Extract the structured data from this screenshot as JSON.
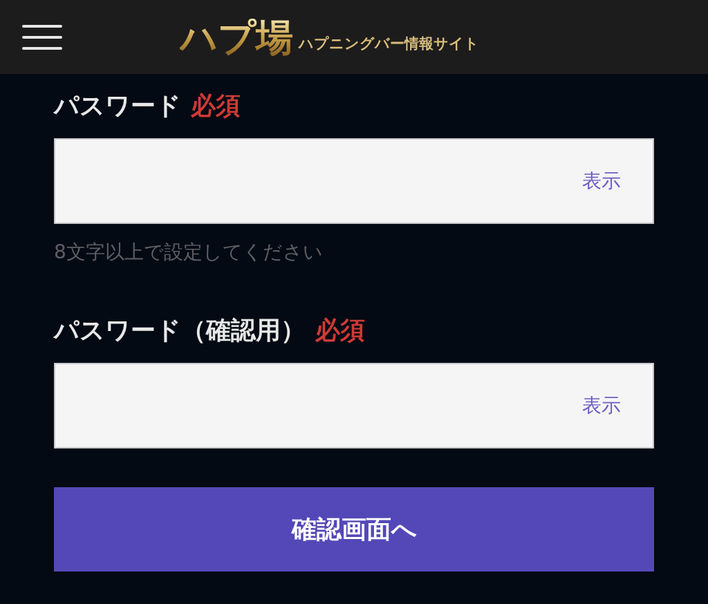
{
  "header": {
    "logo": "ハプ場",
    "tagline": "ハプニングバー情報サイト"
  },
  "fields": [
    {
      "label": "パスワード",
      "required": "必須",
      "toggle": "表示",
      "hint": "8文字以上で設定してください"
    },
    {
      "label": "パスワード（確認用）",
      "required": "必須",
      "toggle": "表示"
    }
  ],
  "submit": "確認画面へ"
}
